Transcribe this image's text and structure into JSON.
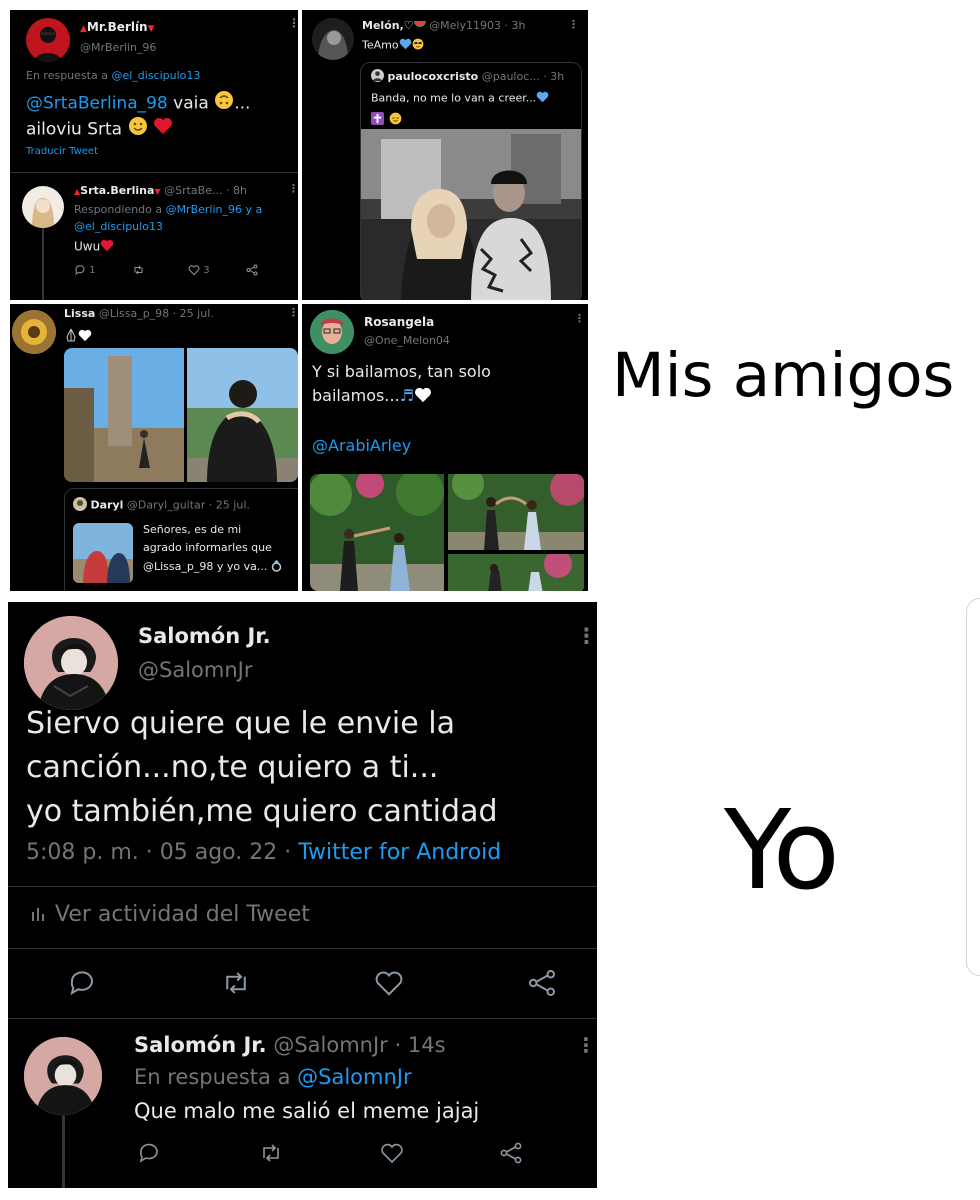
{
  "panel1": {
    "author_name": "Mr.Berlín",
    "author_handle": "@MrBerlin_96",
    "reply_prefix": "En respuesta a",
    "reply_to": "@el_discipulo13",
    "mention": "@SrtaBerlina_98",
    "text_a": "vaia",
    "text_a_end": "...",
    "text_b": "ailoviu Srta",
    "translate": "Traducir Tweet",
    "reply": {
      "author_name": "Srta.Berlina",
      "author_handle": "@SrtaBe...",
      "time": "· 8h",
      "replying_prefix": "Respondiendo a",
      "replying_to": "@MrBerlin_96 y a",
      "replying_to2": "@el_discipulo13",
      "text": "Uwu",
      "replies": "1",
      "likes": "3"
    }
  },
  "panel2": {
    "author_name": "Melón,",
    "author_handle": "@Mely11903",
    "time": "· 3h",
    "text": "TeAmo",
    "quote": {
      "author_name": "paulocoxcristo",
      "author_handle": "@pauloc...",
      "time": "· 3h",
      "text": "Banda, no me lo van a creer..."
    }
  },
  "panel3": {
    "author_name": "Lissa",
    "author_handle": "@Lissa_p_98",
    "time": "· 25 jul.",
    "quote": {
      "author_name": "Daryl",
      "author_handle": "@Daryl_guitar",
      "time": "· 25 jul.",
      "line1": "Señores, es de mi",
      "line2": "agrado informarles que",
      "line3": "@Lissa_p_98 y yo va..."
    }
  },
  "panel4": {
    "author_name": "Rosangela",
    "author_handle": "@One_Melon04",
    "line1": "Y si bailamos, tan solo",
    "line2": "bailamos...",
    "mention": "@ArabiArley"
  },
  "labels": {
    "top": "Mis amigos",
    "bottom": "Yo"
  },
  "main_tweet": {
    "author_name": "Salomón Jr.",
    "author_handle": "@SalomnJr",
    "line1": "Siervo quiere que le envie la",
    "line2": "canción...no,te quiero a ti...",
    "line3": "yo también,me quiero cantidad",
    "timestamp": "5:08 p. m. · 05 ago. 22 ·",
    "source": "Twitter for Android",
    "activity": "Ver actividad del Tweet"
  },
  "reply_tweet": {
    "author_name": "Salomón Jr.",
    "author_handle": "@SalomnJr",
    "time": "· 14s",
    "reply_prefix": "En respuesta a",
    "reply_to": "@SalomnJr",
    "text": "Que malo me salió el meme jajaj"
  },
  "colors": {
    "accent": "#1d9bf0",
    "background": "#000000",
    "text": "#e7e9ea",
    "secondary": "#71767b",
    "heart_red": "#f4212e"
  }
}
